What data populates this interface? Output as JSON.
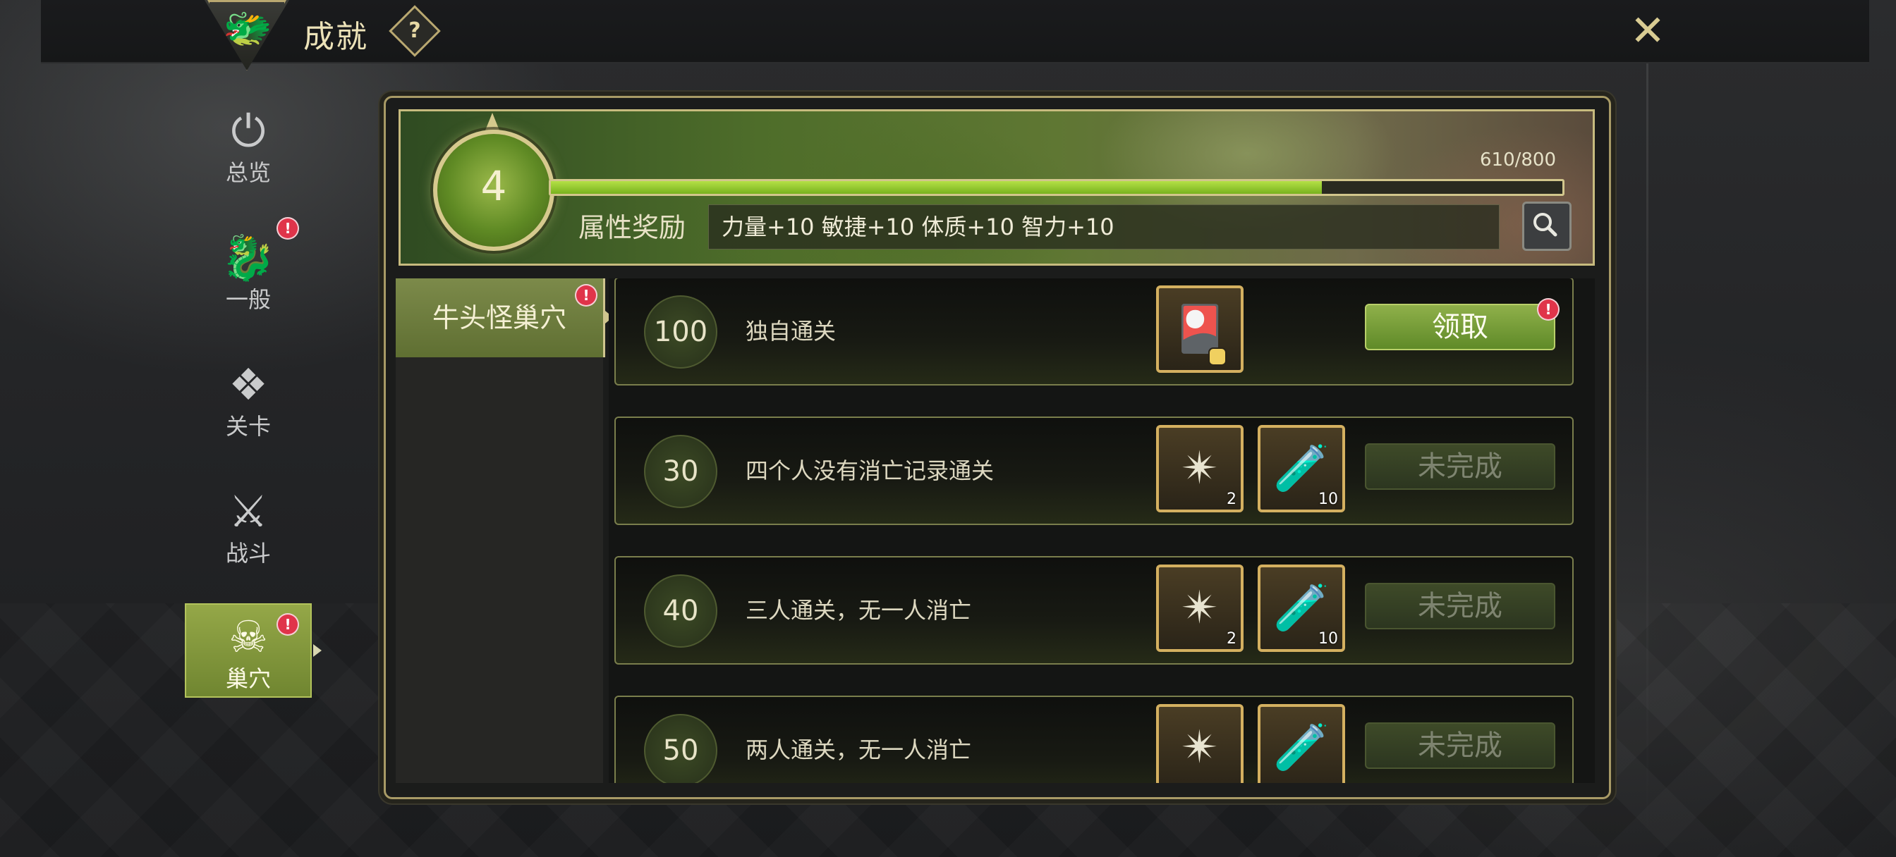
{
  "header": {
    "title": "成就",
    "help_icon": "?",
    "logo_icon": "dragon-emblem",
    "close_icon": "crossed-blades"
  },
  "nav": {
    "items": [
      {
        "label": "总览",
        "icon": "overview-icon",
        "glyph": "⏻",
        "badge": ""
      },
      {
        "label": "一般",
        "icon": "dragon-icon",
        "glyph": "🐉",
        "badge": "!"
      },
      {
        "label": "关卡",
        "icon": "stage-icon",
        "glyph": "❖",
        "badge": ""
      },
      {
        "label": "战斗",
        "icon": "swords-icon",
        "glyph": "⚔",
        "badge": ""
      },
      {
        "label": "巢穴",
        "icon": "lair-skull-icon",
        "glyph": "☠",
        "badge": "!"
      }
    ],
    "active_index": 4
  },
  "banner": {
    "level": "4",
    "progress_text": "610/800",
    "progress_fraction": 0.7625,
    "attr_label": "属性奖励",
    "attr_value": "力量+10 敏捷+10 体质+10 智力+10"
  },
  "category": {
    "tab_label": "牛头怪巢穴",
    "badge": "!"
  },
  "achievements": [
    {
      "score": "100",
      "task": "独自通关",
      "rewards": [
        {
          "icon": "card-ticket-icon",
          "glyph": "🎴",
          "qty": "",
          "locked": true
        }
      ],
      "action": "领取",
      "state": "claim",
      "badge": "!"
    },
    {
      "score": "30",
      "task": "四个人没有消亡记录通关",
      "rewards": [
        {
          "icon": "light-orb-icon",
          "glyph": "✴",
          "qty": "2",
          "locked": false
        },
        {
          "icon": "red-potion-icon",
          "glyph": "🧪",
          "qty": "10",
          "locked": false
        }
      ],
      "action": "未完成",
      "state": "pending",
      "badge": ""
    },
    {
      "score": "40",
      "task": "三人通关，无一人消亡",
      "rewards": [
        {
          "icon": "light-orb-icon",
          "glyph": "✴",
          "qty": "2",
          "locked": false
        },
        {
          "icon": "red-potion-icon",
          "glyph": "🧪",
          "qty": "10",
          "locked": false
        }
      ],
      "action": "未完成",
      "state": "pending",
      "badge": ""
    },
    {
      "score": "50",
      "task": "两人通关，无一人消亡",
      "rewards": [
        {
          "icon": "light-orb-icon",
          "glyph": "✴",
          "qty": "",
          "locked": false
        },
        {
          "icon": "red-potion-icon",
          "glyph": "🧪",
          "qty": "",
          "locked": false
        }
      ],
      "action": "未完成",
      "state": "pending",
      "badge": ""
    }
  ],
  "colors": {
    "accent_green": "#78b21e",
    "gold_border": "#d4b060",
    "badge_red": "#e0344a"
  }
}
